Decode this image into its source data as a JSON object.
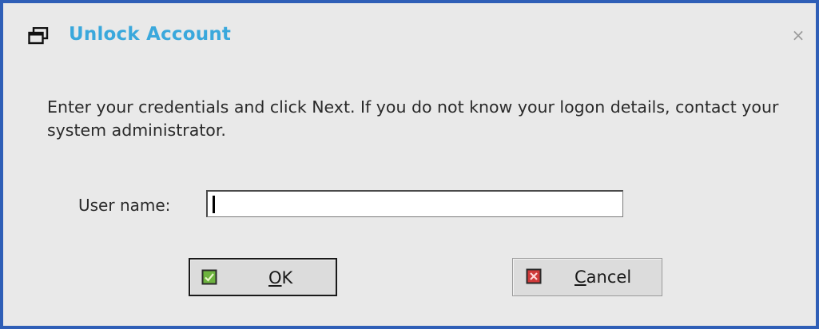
{
  "window": {
    "title": "Unlock Account",
    "window_icon": "window-restore-icon",
    "close_glyph": "×",
    "close_icon": "close-icon",
    "border_color": "#2f5fb7",
    "title_color": "#3aa8dc",
    "background_color": "#e9e9e9"
  },
  "message": {
    "text": "Enter your credentials and click Next. If you do not know your logon details, contact your system administrator."
  },
  "form": {
    "username_label": "User name:",
    "username_value": "",
    "username_placeholder": ""
  },
  "buttons": {
    "ok": {
      "mnemonic": "O",
      "rest": "K",
      "icon": "checkmark-icon",
      "icon_color": "#6db33f"
    },
    "cancel": {
      "mnemonic": "C",
      "rest": "ancel",
      "icon": "x-cross-icon",
      "icon_color": "#d03a3a"
    }
  }
}
